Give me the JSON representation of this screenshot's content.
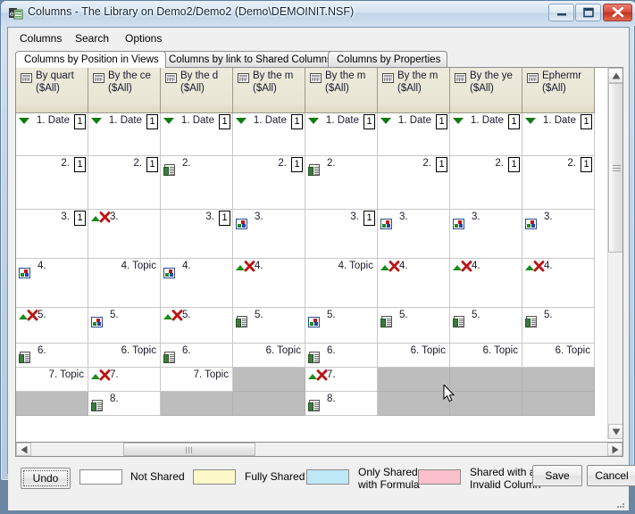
{
  "window": {
    "title": "Columns - The Library on Demo2/Demo2 (Demo\\DEMOINIT.NSF)",
    "icon": "columns-app-icon",
    "minimize_label": "Minimize",
    "maximize_label": "Maximize",
    "close_label": "Close"
  },
  "menubar": {
    "items": [
      {
        "label": "Columns",
        "accel": "m"
      },
      {
        "label": "Search",
        "accel": "e"
      },
      {
        "label": "Options",
        "accel": "O"
      }
    ]
  },
  "tabs": [
    {
      "label": "Columns by Position in Views",
      "active": true
    },
    {
      "label": "Columns by link to Shared Columns",
      "active": false
    },
    {
      "label": "Columns by Properties",
      "active": false
    }
  ],
  "grid": {
    "columns": [
      {
        "name": "By quart",
        "scope": "($All)",
        "icon": "view-icon"
      },
      {
        "name": "By the ce",
        "scope": "($All)",
        "icon": "view-icon"
      },
      {
        "name": "By the d",
        "scope": "($All)",
        "icon": "view-icon"
      },
      {
        "name": "By the m",
        "scope": "($All)",
        "icon": "view-icon"
      },
      {
        "name": "By the m",
        "scope": "($All)",
        "icon": "view-icon"
      },
      {
        "name": "By the m",
        "scope": "($All)",
        "icon": "view-icon"
      },
      {
        "name": "By the ye",
        "scope": "($All)",
        "icon": "view-icon"
      },
      {
        "name": "Ephermr",
        "scope": "($All)",
        "icon": "view-icon"
      }
    ],
    "rows": [
      {
        "height": 48,
        "cells": [
          {
            "text": "1. Date",
            "num": "1",
            "icons": [
              "sort-desc-triangle"
            ]
          },
          {
            "text": "1. Date",
            "num": "1",
            "icons": [
              "sort-desc-triangle"
            ]
          },
          {
            "text": "1. Date",
            "num": "1",
            "icons": [
              "sort-desc-triangle"
            ]
          },
          {
            "text": "1. Date",
            "num": "1",
            "icons": [
              "sort-desc-triangle"
            ]
          },
          {
            "text": "1. Date",
            "num": "1",
            "icons": [
              "sort-desc-triangle"
            ]
          },
          {
            "text": "1. Date",
            "num": "1",
            "icons": [
              "sort-desc-triangle"
            ]
          },
          {
            "text": "1. Date",
            "num": "1",
            "icons": [
              "sort-desc-triangle"
            ]
          },
          {
            "text": "1. Date",
            "num": "1",
            "icons": [
              "sort-desc-triangle"
            ]
          }
        ]
      },
      {
        "height": 60,
        "cells": [
          {
            "text": "2.",
            "num": "1",
            "icons": []
          },
          {
            "text": "2.",
            "num": "1",
            "icons": []
          },
          {
            "text": "2.",
            "num": "",
            "icons": [
              "shared-column-icon"
            ]
          },
          {
            "text": "2.",
            "num": "1",
            "icons": []
          },
          {
            "text": "2.",
            "num": "",
            "icons": [
              "shared-column-icon"
            ]
          },
          {
            "text": "2.",
            "num": "1",
            "icons": []
          },
          {
            "text": "2.",
            "num": "1",
            "icons": []
          },
          {
            "text": "2.",
            "num": "1",
            "icons": []
          }
        ]
      },
      {
        "height": 55,
        "cells": [
          {
            "text": "3.",
            "num": "1",
            "icons": []
          },
          {
            "text": "3.",
            "num": "",
            "icons": [
              "sort-asc-triangle",
              "invalid-x-icon"
            ]
          },
          {
            "text": "3.",
            "num": "1",
            "icons": []
          },
          {
            "text": "3.",
            "num": "",
            "icons": [
              "formula-icon"
            ]
          },
          {
            "text": "3.",
            "num": "1",
            "icons": []
          },
          {
            "text": "3.",
            "num": "",
            "icons": [
              "formula-icon"
            ]
          },
          {
            "text": "3.",
            "num": "",
            "icons": [
              "formula-icon"
            ]
          },
          {
            "text": "3.",
            "num": "",
            "icons": [
              "formula-icon"
            ]
          }
        ]
      },
      {
        "height": 55,
        "cells": [
          {
            "text": "4.",
            "num": "",
            "icons": [
              "formula-icon"
            ]
          },
          {
            "text": "4. Topic",
            "num": "",
            "icons": []
          },
          {
            "text": "4.",
            "num": "",
            "icons": [
              "formula-icon"
            ]
          },
          {
            "text": "4.",
            "num": "",
            "icons": [
              "sort-asc-triangle",
              "invalid-x-icon"
            ]
          },
          {
            "text": "4. Topic",
            "num": "",
            "icons": []
          },
          {
            "text": "4.",
            "num": "",
            "icons": [
              "sort-asc-triangle",
              "invalid-x-icon"
            ]
          },
          {
            "text": "4.",
            "num": "",
            "icons": [
              "sort-asc-triangle",
              "invalid-x-icon"
            ]
          },
          {
            "text": "4.",
            "num": "",
            "icons": [
              "sort-asc-triangle",
              "invalid-x-icon"
            ]
          }
        ]
      },
      {
        "height": 40,
        "cells": [
          {
            "text": "5.",
            "num": "",
            "icons": [
              "sort-asc-triangle",
              "invalid-x-icon"
            ]
          },
          {
            "text": "5.",
            "num": "",
            "icons": [
              "formula-icon"
            ]
          },
          {
            "text": "5.",
            "num": "",
            "icons": [
              "sort-asc-triangle",
              "invalid-x-icon"
            ]
          },
          {
            "text": "5.",
            "num": "",
            "icons": [
              "shared-column-icon"
            ]
          },
          {
            "text": "5.",
            "num": "",
            "icons": [
              "formula-icon"
            ]
          },
          {
            "text": "5.",
            "num": "",
            "icons": [
              "shared-column-icon"
            ]
          },
          {
            "text": "5.",
            "num": "",
            "icons": [
              "shared-column-icon"
            ]
          },
          {
            "text": "5.",
            "num": "",
            "icons": [
              "shared-column-icon"
            ]
          }
        ]
      },
      {
        "height": 27,
        "cells": [
          {
            "text": "6.",
            "num": "",
            "icons": [
              "shared-column-icon"
            ]
          },
          {
            "text": "6. Topic",
            "num": "",
            "icons": []
          },
          {
            "text": "6.",
            "num": "",
            "icons": [
              "shared-column-icon"
            ]
          },
          {
            "text": "6. Topic",
            "num": "",
            "icons": []
          },
          {
            "text": "6.",
            "num": "",
            "icons": [
              "shared-column-icon"
            ]
          },
          {
            "text": "6. Topic",
            "num": "",
            "icons": []
          },
          {
            "text": "6. Topic",
            "num": "",
            "icons": []
          },
          {
            "text": "6. Topic",
            "num": "",
            "icons": []
          }
        ]
      },
      {
        "height": 27,
        "cells": [
          {
            "text": "7. Topic",
            "num": "",
            "icons": []
          },
          {
            "text": "7.",
            "num": "",
            "icons": [
              "sort-asc-triangle",
              "invalid-x-icon"
            ]
          },
          {
            "text": "7. Topic",
            "num": "",
            "icons": []
          },
          {
            "text": "",
            "num": "",
            "icons": [],
            "empty": true
          },
          {
            "text": "7.",
            "num": "",
            "icons": [
              "sort-asc-triangle",
              "invalid-x-icon"
            ]
          },
          {
            "text": "",
            "num": "",
            "icons": [],
            "empty": true
          },
          {
            "text": "",
            "num": "",
            "icons": [],
            "empty": true
          },
          {
            "text": "",
            "num": "",
            "icons": [],
            "empty": true
          }
        ]
      },
      {
        "height": 27,
        "cells": [
          {
            "text": "",
            "num": "",
            "icons": [],
            "empty": true
          },
          {
            "text": "8.",
            "num": "",
            "icons": [
              "shared-column-icon"
            ]
          },
          {
            "text": "",
            "num": "",
            "icons": [],
            "empty": true
          },
          {
            "text": "",
            "num": "",
            "icons": [],
            "empty": true
          },
          {
            "text": "8.",
            "num": "",
            "icons": [
              "shared-column-icon"
            ]
          },
          {
            "text": "",
            "num": "",
            "icons": [],
            "empty": true
          },
          {
            "text": "",
            "num": "",
            "icons": [],
            "empty": true
          },
          {
            "text": "",
            "num": "",
            "icons": [],
            "empty": true
          }
        ]
      }
    ]
  },
  "scrollbars": {
    "vertical_up": "scroll-up",
    "vertical_down": "scroll-down",
    "horizontal_left": "scroll-left",
    "horizontal_right": "scroll-right"
  },
  "legend": [
    {
      "label": "Not Shared",
      "color": "#ffffff"
    },
    {
      "label": "Fully Shared",
      "color": "#fcf8c8"
    },
    {
      "label": "Only Shared\nwith Formula",
      "line1": "Only Shared",
      "line2": "with Formula",
      "color": "#bfe8f7"
    },
    {
      "label": "Shared with an\nInvalid Column",
      "line1": "Shared with an",
      "line2": "Invalid Column",
      "color": "#fbbfcd"
    }
  ],
  "buttons": {
    "undo": "Undo",
    "save": "Save",
    "cancel": "Cancel"
  }
}
